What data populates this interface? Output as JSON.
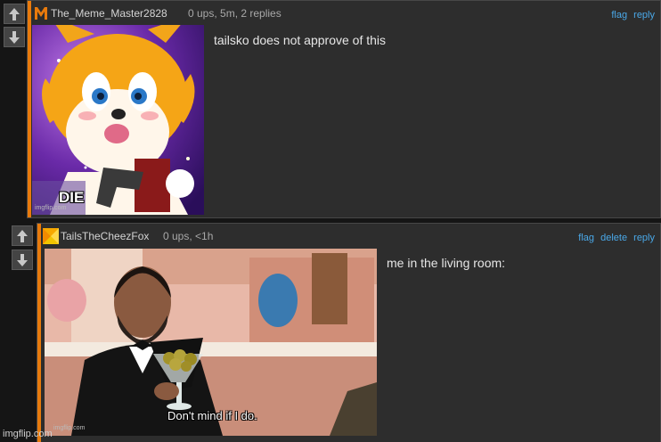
{
  "comments": [
    {
      "username": "The_Meme_Master2828",
      "meta": "0 ups, 5m, 2 replies",
      "actions": [
        "flag",
        "reply"
      ],
      "text": "tailsko does not approve of this",
      "image": {
        "caption": "DIE",
        "watermark": "imgflip.com"
      }
    },
    {
      "username": "TailsTheCheezFox",
      "meta": "0 ups, <1h",
      "actions": [
        "flag",
        "delete",
        "reply"
      ],
      "text": "me in the living room:",
      "image": {
        "caption": "Don't mind if I do.",
        "watermark": "imgflip.com"
      }
    }
  ],
  "footer": {
    "watermark": "imgflip.com"
  },
  "colors": {
    "accent": "#e87a0c",
    "link": "#4aa8e8",
    "panel": "#2d2d2d",
    "page": "#151515"
  }
}
